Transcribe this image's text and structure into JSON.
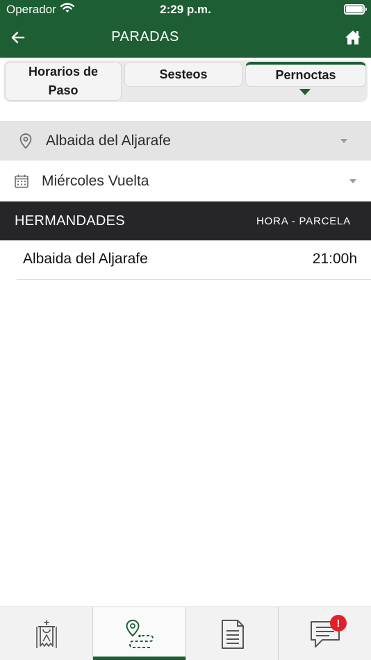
{
  "status_bar": {
    "carrier": "Operador",
    "time": "2:29 p.m."
  },
  "nav": {
    "title": "PARADAS",
    "back_icon": "arrow-left-icon",
    "home_icon": "home-icon"
  },
  "tabs": [
    {
      "label": "Horarios de Paso",
      "selected": false
    },
    {
      "label": "Sesteos",
      "selected": false
    },
    {
      "label": "Pernoctas",
      "selected": true
    }
  ],
  "filters": {
    "location": {
      "icon": "location-pin-icon",
      "value": "Albaida del Aljarafe"
    },
    "day": {
      "icon": "calendar-icon",
      "value": "Miércoles Vuelta"
    }
  },
  "table": {
    "header_left": "HERMANDADES",
    "header_right": "HORA - PARCELA",
    "rows": [
      {
        "name": "Albaida del Aljarafe",
        "time": "21:00h"
      }
    ]
  },
  "tabbar": {
    "items": [
      {
        "icon": "hermandad-icon",
        "active": false
      },
      {
        "icon": "route-icon",
        "active": true
      },
      {
        "icon": "document-icon",
        "active": false
      },
      {
        "icon": "chat-icon",
        "active": false,
        "badge": "!"
      }
    ]
  },
  "colors": {
    "brand_green": "#1d5e35",
    "table_header": "#262629",
    "badge_red": "#e3202a"
  }
}
